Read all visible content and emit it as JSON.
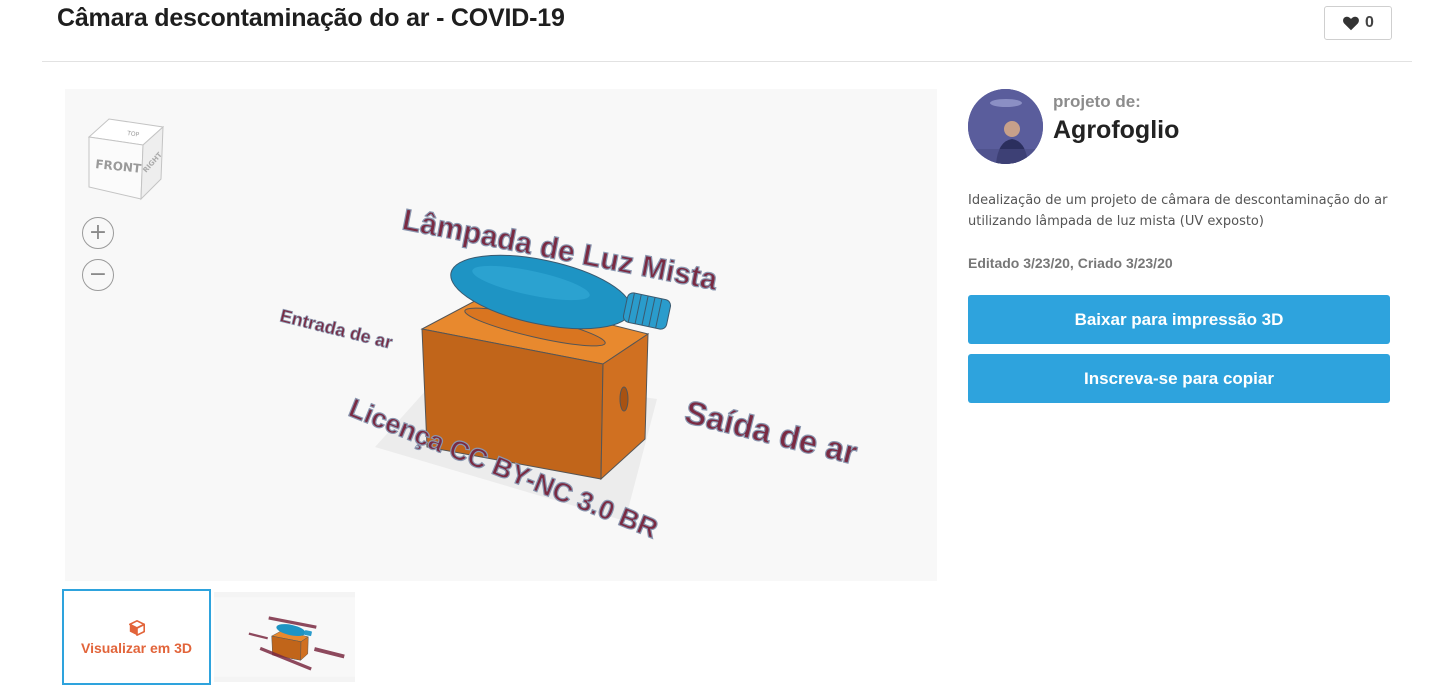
{
  "header": {
    "title": "Câmara descontaminação do ar - COVID-19",
    "like_count": "0"
  },
  "viewer": {
    "viewcube": {
      "top": "TOP",
      "front": "FRONT",
      "right": "RIGHT"
    },
    "zoom_in": "+",
    "zoom_out": "−",
    "model_labels": {
      "lamp": "Lâmpada de Luz Mista",
      "intake": "Entrada de ar",
      "outlet": "Saída de ar",
      "license": "Licença CC BY-NC 3.0 BR"
    }
  },
  "thumbnails": {
    "view3d_label": "Visualizar em 3D"
  },
  "sidebar": {
    "by_label": "projeto de:",
    "author": "Agrofoglio",
    "description": "Idealização de um projeto de câmara de descontaminação do ar utilizando lâmpada de luz mista (UV exposto)",
    "dates": "Editado 3/23/20, Criado 3/23/20",
    "download_button": "Baixar para impressão 3D",
    "subscribe_button": "Inscreva-se para copiar"
  },
  "colors": {
    "accent": "#2ea3dd",
    "orange_icon": "#e2643a",
    "model_box": "#e07b22",
    "model_lamp": "#1e94c4",
    "model_text": "#7a2a42"
  },
  "icons": [
    "heart-icon",
    "cube-icon",
    "zoom-in-icon",
    "zoom-out-icon"
  ]
}
